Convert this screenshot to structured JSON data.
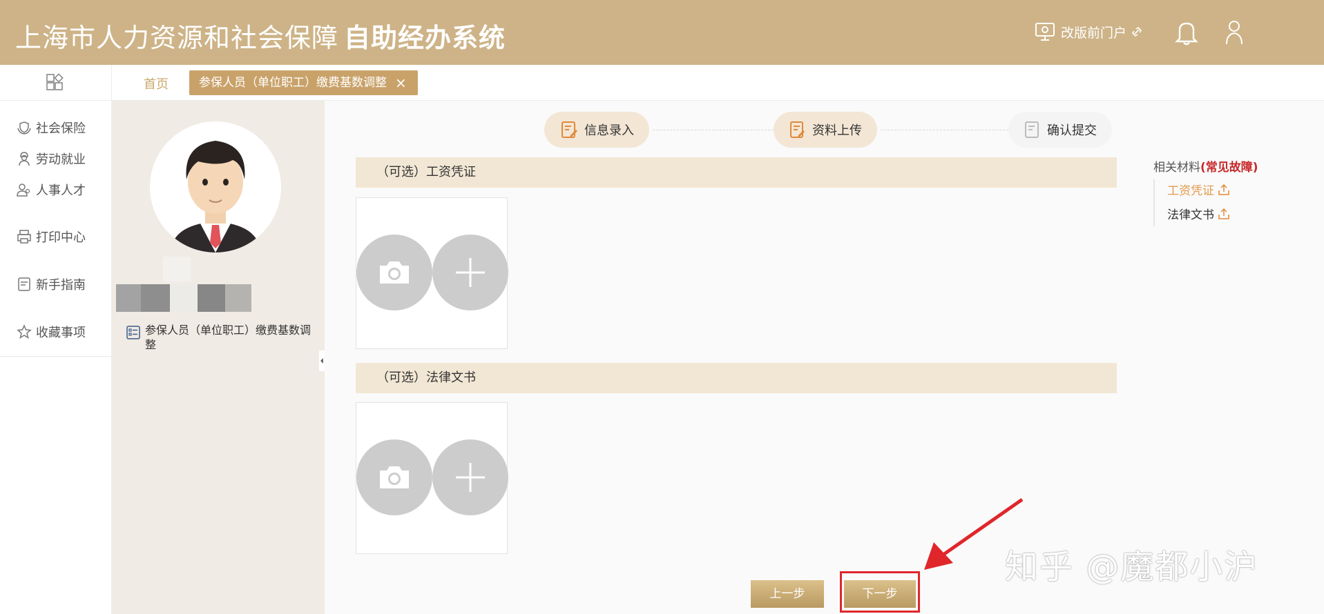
{
  "header": {
    "title": "上海市人力资源和社会保障",
    "title_bold": "自助经办系统",
    "portal_link": "改版前门户"
  },
  "tabs": {
    "home": "首页",
    "active": "参保人员（单位职工）缴费基数调整",
    "close": "×"
  },
  "leftnav": {
    "items": [
      {
        "label": "社会保险",
        "icon": "hands-shield-icon"
      },
      {
        "label": "劳动就业",
        "icon": "worker-icon"
      },
      {
        "label": "人事人才",
        "icon": "people-icon"
      },
      {
        "label": "打印中心",
        "icon": "printer-icon"
      },
      {
        "label": "新手指南",
        "icon": "guide-icon"
      },
      {
        "label": "收藏事项",
        "icon": "star-icon"
      }
    ]
  },
  "profile": {
    "business": "参保人员（单位职工）缴费基数调整"
  },
  "steps": [
    {
      "label": "信息录入",
      "state": "done"
    },
    {
      "label": "资料上传",
      "state": "current"
    },
    {
      "label": "确认提交",
      "state": "todo"
    }
  ],
  "sections": [
    {
      "title": "（可选）工资凭证"
    },
    {
      "title": "（可选）法律文书"
    }
  ],
  "buttons": {
    "prev": "上一步",
    "next": "下一步"
  },
  "related": {
    "heading": "相关材料",
    "faults": "(常见故障)",
    "items": [
      {
        "label": "工资凭证",
        "active": true
      },
      {
        "label": "法律文书",
        "active": false
      }
    ]
  },
  "watermark": "知乎 @魔都小沪",
  "colors": {
    "header": "#cdb387",
    "accent": "#c9a26a",
    "highlight": "#e0262b",
    "fault_red": "#c8282a"
  }
}
